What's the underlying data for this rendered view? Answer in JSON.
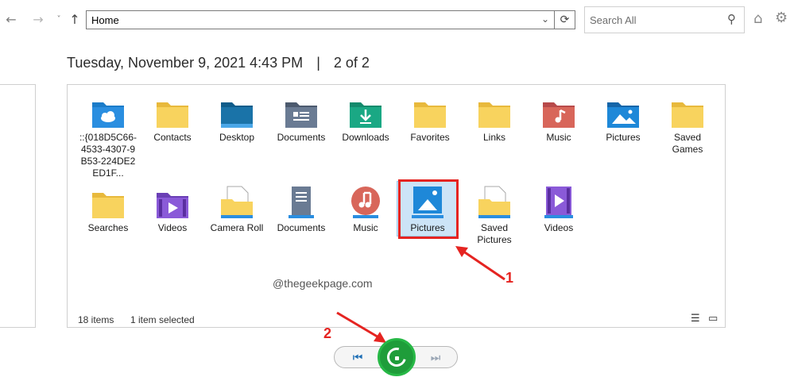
{
  "toolbar": {
    "back_icon": "back-arrow-icon",
    "forward_icon": "forward-arrow-icon",
    "recent_icon": "recent-locations-icon",
    "up_icon": "up-arrow-icon",
    "address": "Home",
    "search_placeholder": "Search All"
  },
  "header": {
    "date": "Tuesday, November 9, 2021 4:43 PM",
    "separator": "|",
    "page": "2 of 2"
  },
  "items": [
    {
      "label": "::{018D5C66-4533-4307-9B53-224DE2ED1F...",
      "icon": "onedrive-folder-icon"
    },
    {
      "label": "Contacts",
      "icon": "folder-icon"
    },
    {
      "label": "Desktop",
      "icon": "desktop-folder-icon"
    },
    {
      "label": "Documents",
      "icon": "documents-folder-icon"
    },
    {
      "label": "Downloads",
      "icon": "downloads-folder-icon"
    },
    {
      "label": "Favorites",
      "icon": "folder-icon"
    },
    {
      "label": "Links",
      "icon": "folder-icon"
    },
    {
      "label": "Music",
      "icon": "music-folder-icon"
    },
    {
      "label": "Pictures",
      "icon": "pictures-folder-icon"
    },
    {
      "label": "Saved Games",
      "icon": "folder-icon"
    },
    {
      "label": "Searches",
      "icon": "folder-icon"
    },
    {
      "label": "Videos",
      "icon": "videos-folder-icon"
    },
    {
      "label": "Camera Roll",
      "icon": "file-folder-icon"
    },
    {
      "label": "Documents",
      "icon": "documents-library-icon"
    },
    {
      "label": "Music",
      "icon": "music-library-icon"
    },
    {
      "label": "Pictures",
      "icon": "pictures-library-icon"
    },
    {
      "label": "Saved Pictures",
      "icon": "file-folder-icon"
    },
    {
      "label": "Videos",
      "icon": "videos-library-icon"
    }
  ],
  "status": {
    "count": "18 items",
    "selected": "1 item selected"
  },
  "watermark": "@thegeekpage.com",
  "annotations": {
    "one": "1",
    "two": "2"
  },
  "colors": {
    "accent": "#1f9d3a",
    "annotation": "#e52421",
    "selection": "#cce4f7"
  }
}
